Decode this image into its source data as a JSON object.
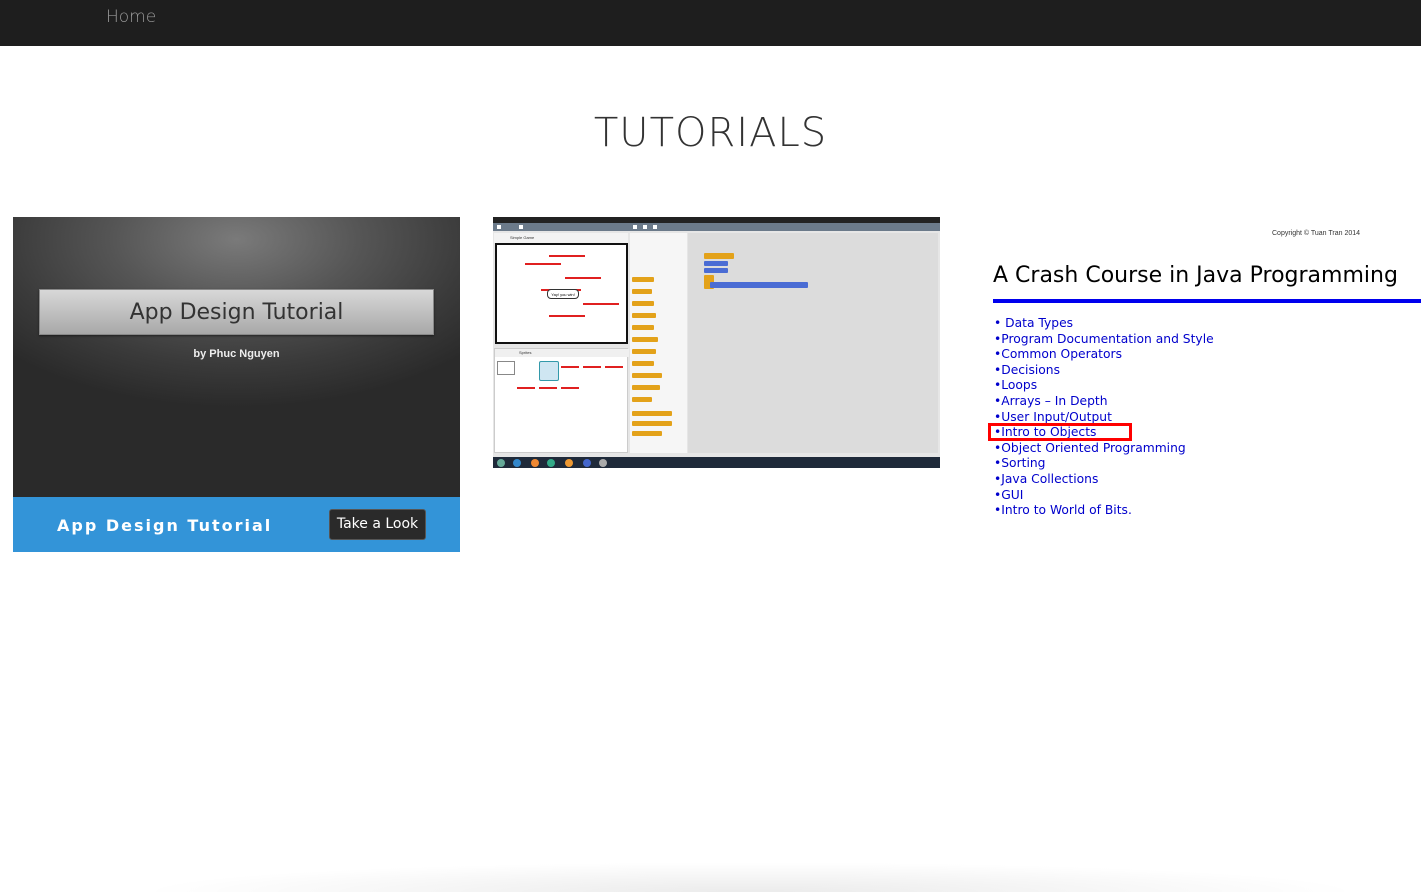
{
  "nav": {
    "home": "Home"
  },
  "page": {
    "title": "TUTORIALS"
  },
  "card1": {
    "banner_title": "App Design Tutorial",
    "byline": "by Phuc Nguyen",
    "bar_title": "App Design Tutorial",
    "button_label": "Take a Look",
    "bar_color": "#3394d8"
  },
  "card2": {
    "stage_header": "Simple Game",
    "sprites_header": "Sprites",
    "speech": "Yay! you win!"
  },
  "card3": {
    "copyright": "Copyright © Tuan Tran 2014",
    "title": "A Crash Course in Java Programming",
    "items": [
      "• Data Types",
      "•Program Documentation and Style",
      "•Common Operators",
      "•Decisions",
      "•Loops",
      "•Arrays – In Depth",
      "•User Input/Output",
      "•Intro to Objects",
      "•Object Oriented Programming",
      "•Sorting",
      "•Java Collections",
      "•GUI",
      "•Intro to World of Bits."
    ],
    "highlight_color": "#ff0000"
  }
}
